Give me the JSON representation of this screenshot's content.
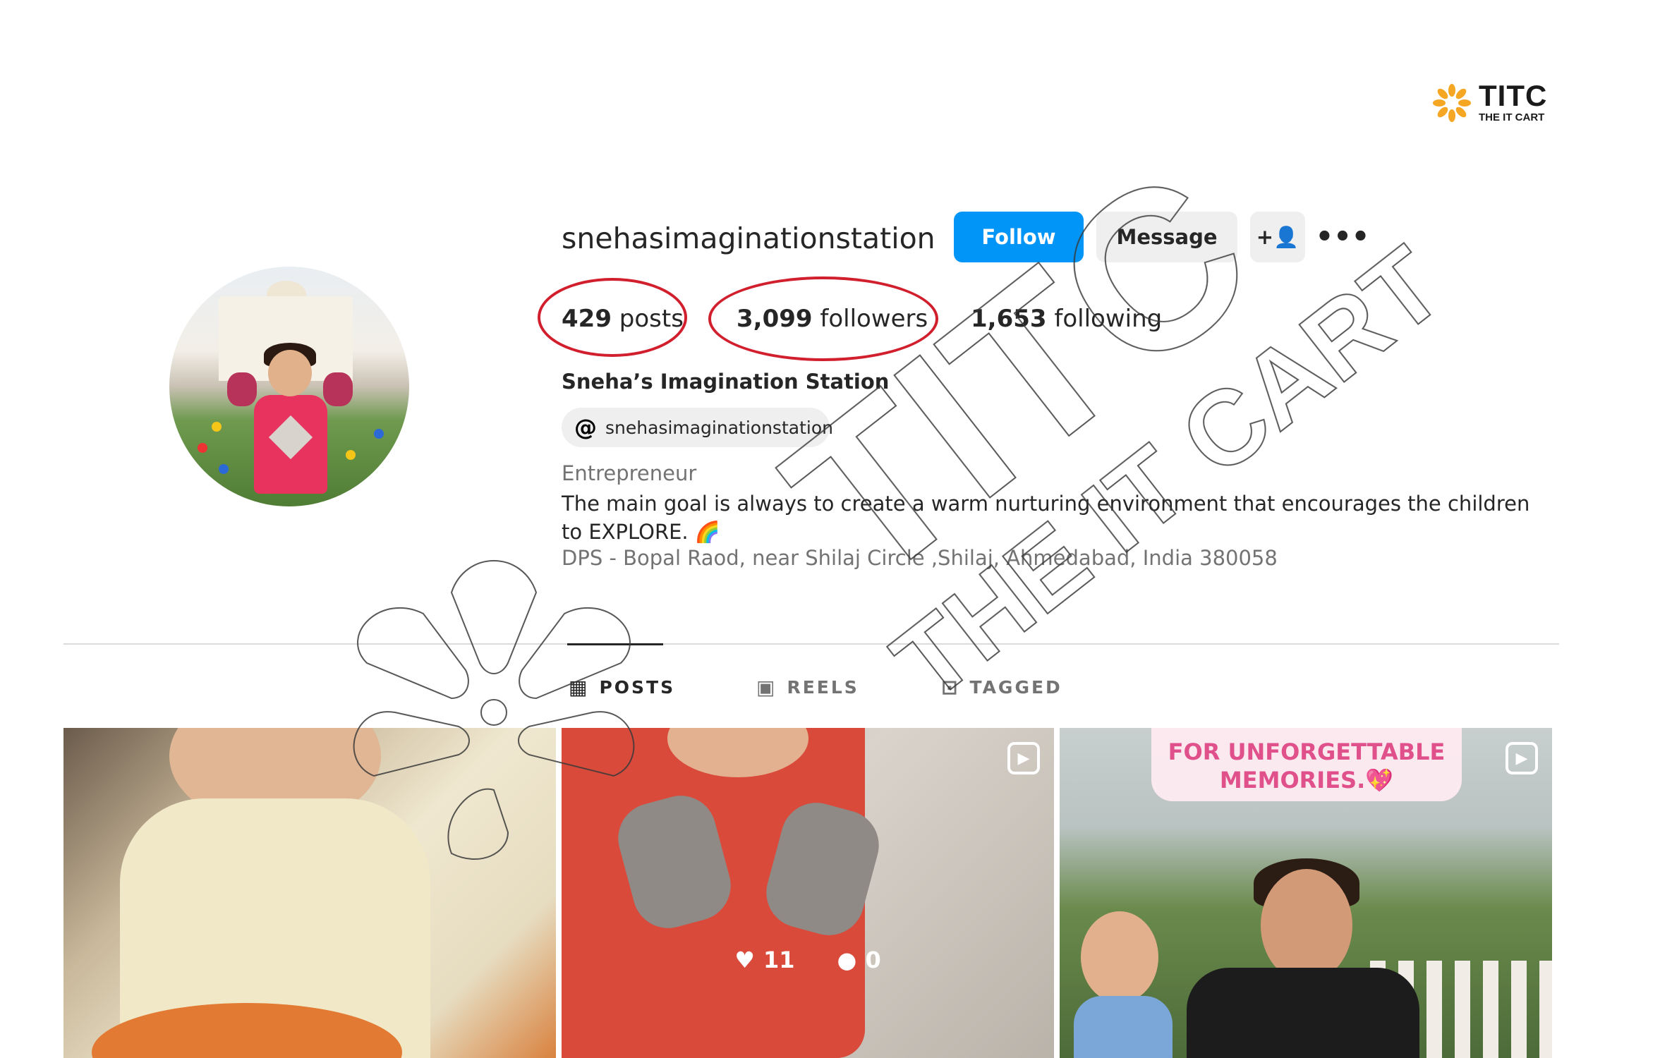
{
  "watermark": {
    "brand": "TITC",
    "tagline": "THE IT CART"
  },
  "profile": {
    "username": "snehasimaginationstation",
    "full_name": "Sneha’s Imagination Station",
    "threads_handle": "snehasimaginationstation",
    "category": "Entrepreneur",
    "bio": "The main goal is always to create a warm nurturing environment that encourages the children to EXPLORE. 🌈",
    "address": "DPS - Bopal Raod, near Shilaj Circle ,Shilaj, Ahmedabad, India 380058"
  },
  "actions": {
    "follow_label": "Follow",
    "message_label": "Message",
    "add_user_icon": "+👤",
    "more_icon": "•••"
  },
  "stats": {
    "posts_count": "429",
    "posts_label": "posts",
    "followers_count": "3,099",
    "followers_label": "followers",
    "following_count": "1,653",
    "following_label": "following"
  },
  "tabs": [
    {
      "label": "POSTS",
      "icon": "grid-icon",
      "active": true
    },
    {
      "label": "REELS",
      "icon": "reels-icon",
      "active": false
    },
    {
      "label": "TAGGED",
      "icon": "tagged-icon",
      "active": false
    }
  ],
  "grid": [
    {
      "type": "photo"
    },
    {
      "type": "reel",
      "likes": "11",
      "comments": "0"
    },
    {
      "type": "reel",
      "caption_line1": "FOR UNFORGETTABLE",
      "caption_line2": "MEMORIES.💖"
    }
  ],
  "colors": {
    "follow_blue": "#0095f6",
    "annotation_red": "#d11f2d",
    "titc_orange": "#f5a623"
  }
}
